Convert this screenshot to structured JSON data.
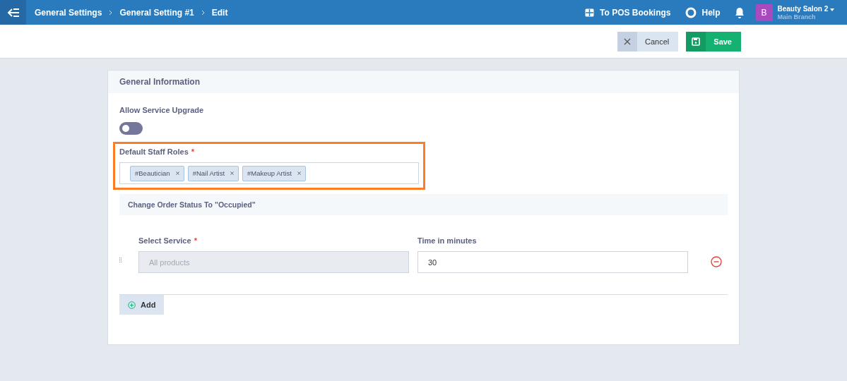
{
  "topbar": {
    "breadcrumbs": [
      "General Settings",
      "General Setting #1",
      "Edit"
    ],
    "pos_link": "To POS Bookings",
    "help": "Help",
    "account": {
      "initial": "B",
      "name": "Beauty Salon 2",
      "branch": "Main Branch"
    }
  },
  "actions": {
    "cancel": "Cancel",
    "save": "Save"
  },
  "card": {
    "title": "General Information",
    "toggle": {
      "label": "Allow Service Upgrade",
      "on": false
    },
    "roles": {
      "label": "Default Staff Roles",
      "required": "*",
      "highlighted": true,
      "tags": [
        "#Beautician",
        "#Nail Artist",
        "#Makeup Artist"
      ]
    },
    "section_title": "Change Order Status To \"Occupied\"",
    "rows": [
      {
        "service_label": "Select Service",
        "service_required": "*",
        "service_placeholder": "All products",
        "service_disabled": true,
        "time_label": "Time in minutes",
        "time_value": "30"
      }
    ],
    "add": "Add"
  }
}
